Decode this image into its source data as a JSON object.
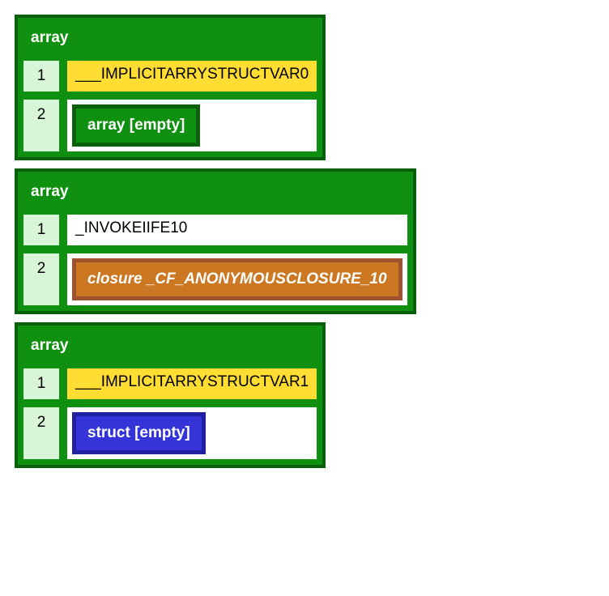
{
  "tables": [
    {
      "header": "array",
      "rows": [
        {
          "index": "1",
          "type": "text",
          "value": "___IMPLICITARRYSTRUCTVAR0",
          "highlight": true
        },
        {
          "index": "2",
          "type": "nested-array",
          "value": "array [empty]"
        }
      ]
    },
    {
      "header": "array",
      "rows": [
        {
          "index": "1",
          "type": "text",
          "value": "_INVOKEIIFE10",
          "highlight": false
        },
        {
          "index": "2",
          "type": "nested-closure",
          "value": "closure _CF_ANONYMOUSCLOSURE_10"
        }
      ]
    },
    {
      "header": "array",
      "rows": [
        {
          "index": "1",
          "type": "text",
          "value": "___IMPLICITARRYSTRUCTVAR1",
          "highlight": true
        },
        {
          "index": "2",
          "type": "nested-struct",
          "value": "struct [empty]"
        }
      ]
    }
  ]
}
